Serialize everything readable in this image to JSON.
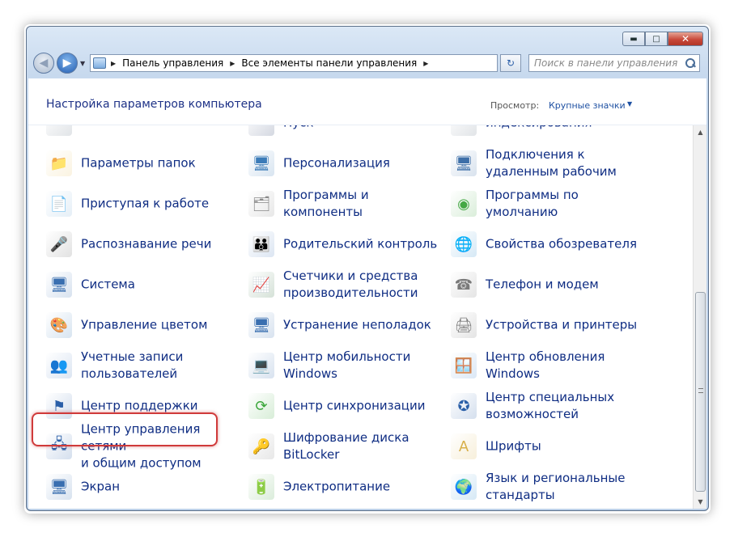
{
  "window": {
    "controls": {
      "minimize": "▬",
      "maximize": "□",
      "close": "✕"
    }
  },
  "nav": {
    "back": "◀",
    "forward": "▶",
    "dropdown": "▼",
    "breadcrumb": [
      "Панель управления",
      "Все элементы панели управления"
    ],
    "separator": "▶",
    "refresh": "↻",
    "search_placeholder": "Поиск в панели управления"
  },
  "header": {
    "title": "Настройка параметров компьютера",
    "view_label": "Просмотр:",
    "view_value": "Крупные значки",
    "view_arrow": "▼"
  },
  "items": [
    {
      "label": "",
      "icon": "partial-icon-1",
      "glyph": "",
      "color": "#6a7a8a"
    },
    {
      "label": "Пуск",
      "icon": "taskbar-icon",
      "glyph": "",
      "color": "#2a3d6a"
    },
    {
      "label": "индексирования",
      "icon": "indexing-icon",
      "glyph": "",
      "color": "#6a7a8a"
    },
    {
      "label": "Параметры папок",
      "icon": "folder-options-icon",
      "glyph": "📁",
      "color": "#e8c468"
    },
    {
      "label": "Персонализация",
      "icon": "personalization-icon",
      "glyph": "🖥",
      "color": "#3b7bb8"
    },
    {
      "label": "Подключения к\nудаленным рабочим",
      "icon": "remote-desktop-icon",
      "glyph": "🖥",
      "color": "#3e6fa8"
    },
    {
      "label": "Приступая к работе",
      "icon": "getting-started-icon",
      "glyph": "📄",
      "color": "#7fb0d8"
    },
    {
      "label": "Программы и\nкомпоненты",
      "icon": "programs-icon",
      "glyph": "🗂",
      "color": "#8a8a8a"
    },
    {
      "label": "Программы по\nумолчанию",
      "icon": "default-programs-icon",
      "glyph": "◉",
      "color": "#45a845"
    },
    {
      "label": "Распознавание речи",
      "icon": "microphone-icon",
      "glyph": "🎤",
      "color": "#6d6d6d"
    },
    {
      "label": "Родительский контроль",
      "icon": "parental-control-icon",
      "glyph": "👪",
      "color": "#4f7fbf"
    },
    {
      "label": "Свойства обозревателя",
      "icon": "internet-options-icon",
      "glyph": "🌐",
      "color": "#2f8fd0"
    },
    {
      "label": "Система",
      "icon": "system-icon",
      "glyph": "🖥",
      "color": "#3a6fb0"
    },
    {
      "label": "Счетчики и средства\nпроизводительности",
      "icon": "performance-icon",
      "glyph": "📈",
      "color": "#2d6b3a"
    },
    {
      "label": "Телефон и модем",
      "icon": "phone-modem-icon",
      "glyph": "☎",
      "color": "#7a7a7a"
    },
    {
      "label": "Управление цветом",
      "icon": "color-management-icon",
      "glyph": "🎨",
      "color": "#3b7bb8"
    },
    {
      "label": "Устранение неполадок",
      "icon": "troubleshooting-icon",
      "glyph": "🖥",
      "color": "#3a6fb0"
    },
    {
      "label": "Устройства и принтеры",
      "icon": "devices-printers-icon",
      "glyph": "🖨",
      "color": "#7a7a7a"
    },
    {
      "label": "Учетные записи\nпользователей",
      "icon": "user-accounts-icon",
      "glyph": "👥",
      "color": "#4f7fbf"
    },
    {
      "label": "Центр мобильности\nWindows",
      "icon": "mobility-center-icon",
      "glyph": "💻",
      "color": "#3a6fb0"
    },
    {
      "label": "Центр обновления\nWindows",
      "icon": "windows-update-icon",
      "glyph": "🪟",
      "color": "#4a8ad0"
    },
    {
      "label": "Центр поддержки",
      "icon": "action-center-flag-icon",
      "glyph": "⚑",
      "color": "#2a5fa8"
    },
    {
      "label": "Центр синхронизации",
      "icon": "sync-center-icon",
      "glyph": "⟳",
      "color": "#3aa63a"
    },
    {
      "label": "Центр специальных\nвозможностей",
      "icon": "ease-of-access-icon",
      "glyph": "✪",
      "color": "#2a5fa8"
    },
    {
      "label": "Центр управления сетями\nи общим доступом",
      "icon": "network-center-icon",
      "glyph": "🖧",
      "color": "#2a5fa8"
    },
    {
      "label": "Шифрование диска\nBitLocker",
      "icon": "bitlocker-icon",
      "glyph": "🔑",
      "color": "#8a8a8a"
    },
    {
      "label": "Шрифты",
      "icon": "fonts-icon",
      "glyph": "A",
      "color": "#d8b04a"
    },
    {
      "label": "Экран",
      "icon": "display-icon",
      "glyph": "🖥",
      "color": "#3a6fb0"
    },
    {
      "label": "Электропитание",
      "icon": "power-options-icon",
      "glyph": "🔋",
      "color": "#4aa34a"
    },
    {
      "label": "Язык и региональные\nстандарты",
      "icon": "region-language-icon",
      "glyph": "🌍",
      "color": "#2f8fd0"
    }
  ],
  "highlight": {
    "color": "#d03a3a"
  },
  "scrollbar": {
    "up": "▲",
    "down": "▼"
  }
}
